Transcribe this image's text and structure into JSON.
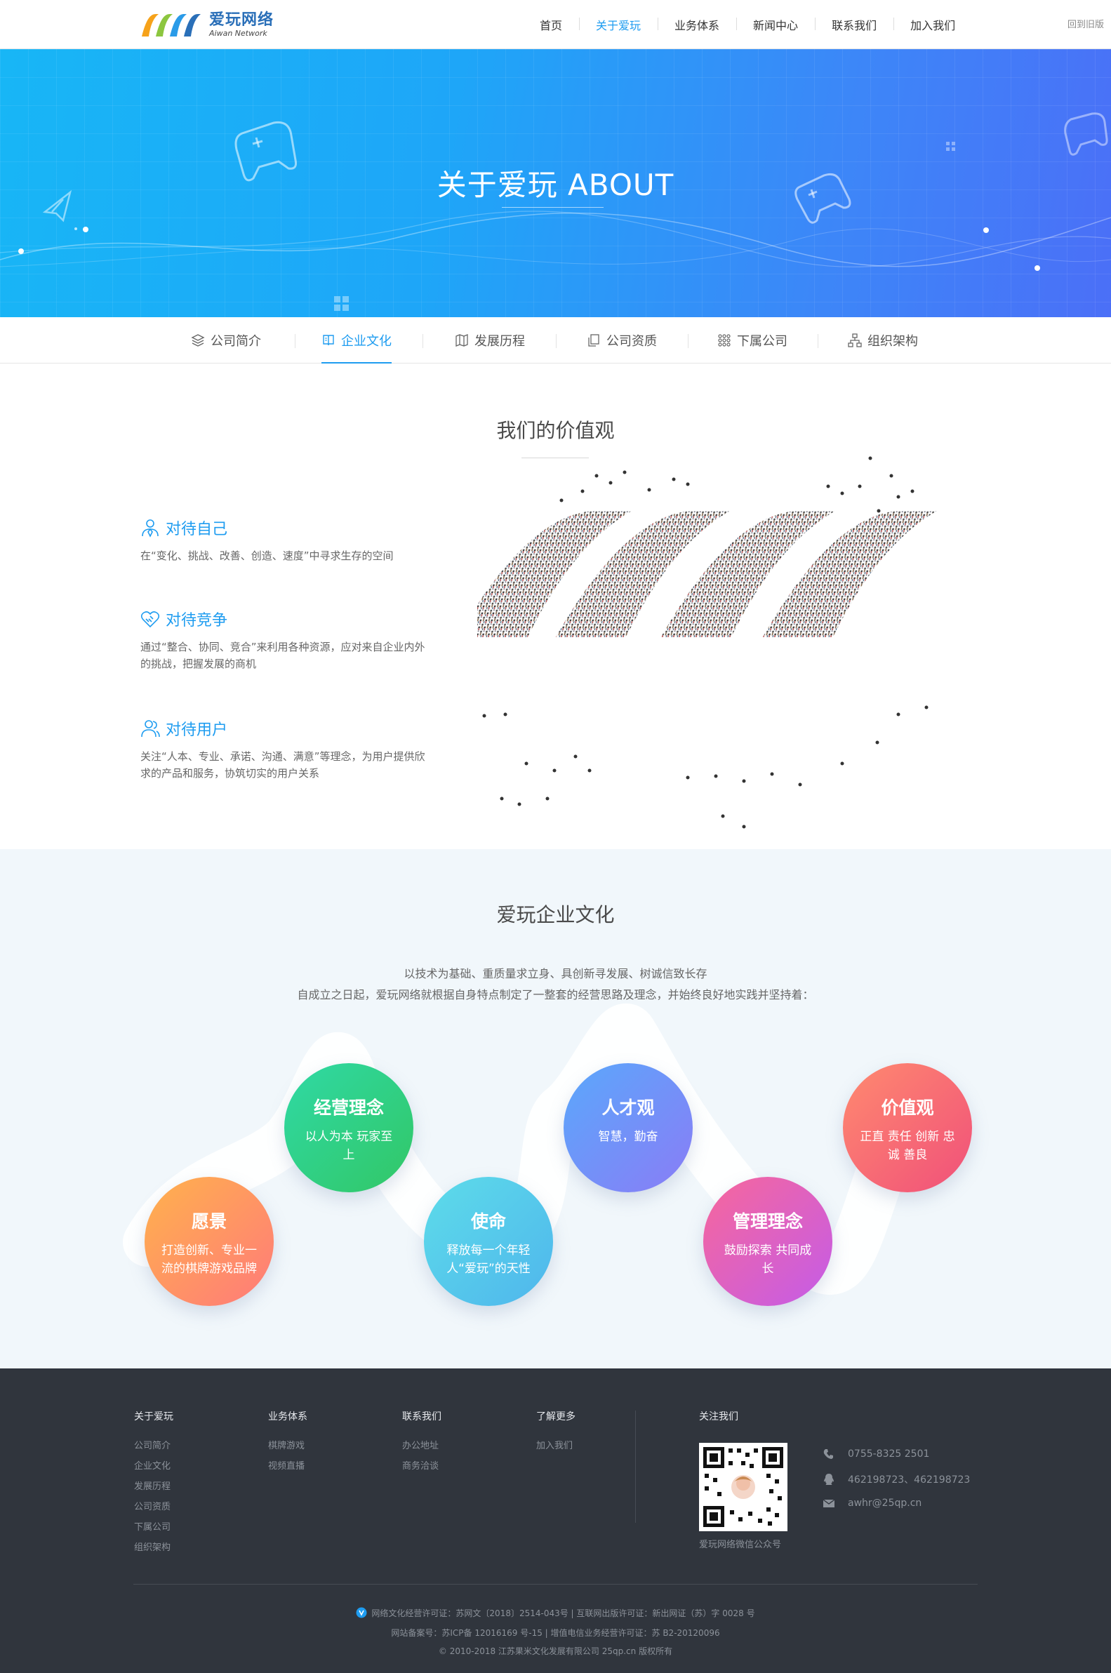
{
  "header": {
    "logo_cn": "爱玩网络",
    "logo_en": "Aiwan Network",
    "nav": [
      "首页",
      "关于爱玩",
      "业务体系",
      "新闻中心",
      "联系我们",
      "加入我们"
    ],
    "active_nav": "关于爱玩",
    "old_version": "回到旧版"
  },
  "banner": {
    "title": "关于爱玩  ABOUT"
  },
  "tabs": [
    "公司简介",
    "企业文化",
    "发展历程",
    "公司资质",
    "下属公司",
    "组织架构"
  ],
  "active_tab": "企业文化",
  "values": {
    "title": "我们的价值观",
    "items": [
      {
        "title": "对待自己",
        "desc": "在“变化、挑战、改善、创造、速度”中寻求生存的空间"
      },
      {
        "title": "对待竞争",
        "desc": "通过“整合、协同、竞合”来利用各种资源，应对来自企业内外的挑战，把握发展的商机"
      },
      {
        "title": "对待用户",
        "desc": "关注“人本、专业、承诺、沟通、满意”等理念，为用户提供欣求的产品和服务，协筑切实的用户关系"
      }
    ]
  },
  "culture": {
    "title": "爱玩企业文化",
    "line1": "以技术为基础、重质量求立身、具创新寻发展、树诚信致长存",
    "line2": "自成立之日起，爱玩网络就根据自身特点制定了一整套的经营思路及理念，并始终良好地实践并坚持着：",
    "circles": [
      {
        "title": "愿景",
        "text": "打造创新、专业一流的棋牌游戏品牌",
        "color_from": "#ffb24c",
        "color_to": "#ff7a7a"
      },
      {
        "title": "经营理念",
        "text": "以人为本 玩家至上",
        "color_from": "#2fd9a5",
        "color_to": "#32c766"
      },
      {
        "title": "使命",
        "text": "释放每一个年轻人“爱玩”的天性",
        "color_from": "#5ddcea",
        "color_to": "#4fb6ec"
      },
      {
        "title": "人才观",
        "text": "智慧，勤奋",
        "color_from": "#5aa8fb",
        "color_to": "#8a7cf6"
      },
      {
        "title": "管理理念",
        "text": "鼓励探索 共同成长",
        "color_from": "#f7679b",
        "color_to": "#c45ce8"
      },
      {
        "title": "价值观",
        "text": "正直 责任 创新 忠诚 善良",
        "color_from": "#ff8a6f",
        "color_to": "#f0507a"
      }
    ]
  },
  "footer": {
    "columns": [
      {
        "title": "关于爱玩",
        "links": [
          "公司简介",
          "企业文化",
          "发展历程",
          "公司资质",
          "下属公司",
          "组织架构"
        ]
      },
      {
        "title": "业务体系",
        "links": [
          "棋牌游戏",
          "视频直播"
        ]
      },
      {
        "title": "联系我们",
        "links": [
          "办公地址",
          "商务洽谈"
        ]
      },
      {
        "title": "了解更多",
        "links": [
          "加入我们"
        ]
      }
    ],
    "follow_title": "关注我们",
    "qr_caption": "爱玩网络微信公众号",
    "phone": "0755-8325 2501",
    "qq": "462198723、462198723",
    "email": "awhr@25qp.cn",
    "copy1": "网络文化经营许可证：苏网文〔2018〕2514-043号  |  互联网出版许可证：新出网证（苏）字 0028 号",
    "copy2": "网站备案号：苏ICP备 12016169 号-15  |  增值电信业务经营许可证：苏 B2-20120096",
    "copy3": "© 2010-2018 江苏果米文化发展有限公司 25qp.cn 版权所有"
  }
}
